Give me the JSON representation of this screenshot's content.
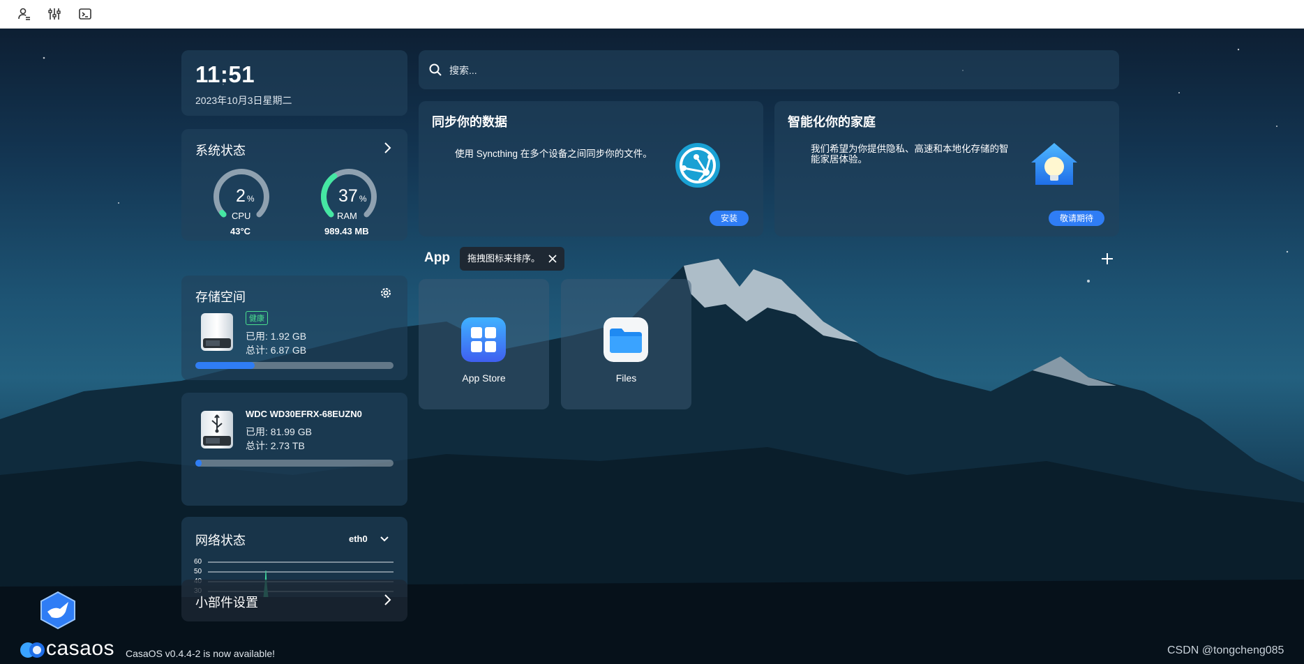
{
  "topbar": {
    "icons": [
      "user-settings-icon",
      "sliders-icon",
      "terminal-icon"
    ]
  },
  "clock": {
    "time": "11:51",
    "date": "2023年10月3日星期二"
  },
  "system_status": {
    "title": "系统状态",
    "cpu": {
      "value": "2",
      "unit": "%",
      "label": "CPU",
      "sub": "43°C",
      "percent": 2
    },
    "ram": {
      "value": "37",
      "unit": "%",
      "label": "RAM",
      "sub": "989.43 MB",
      "percent": 37
    }
  },
  "storage": {
    "title": "存储空间",
    "badge": "健康",
    "used": "已用: 1.92 GB",
    "total": "总计: 6.87 GB",
    "used_fraction": 0.3
  },
  "usb_disk": {
    "name": "WDC WD30EFRX-68EUZN0",
    "used": "已用: 81.99 GB",
    "total": "总计: 2.73 TB",
    "used_fraction": 0.03
  },
  "network": {
    "title": "网络状态",
    "interface": "eth0",
    "y_ticks": [
      "60",
      "50",
      "40",
      "30"
    ]
  },
  "widget_settings": {
    "label": "小部件设置"
  },
  "search": {
    "placeholder": "搜索..."
  },
  "cards": {
    "sync": {
      "title": "同步你的数据",
      "desc": "使用 Syncthing 在多个设备之间同步你的文件。",
      "button": "安装"
    },
    "home": {
      "title": "智能化你的家庭",
      "desc_line1": "我们希望为你提供隐私、高速和本地化存储的智",
      "desc_line2": "能家居体验。",
      "button": "敬请期待"
    }
  },
  "apps": {
    "title": "App",
    "tooltip": "拖拽图标来排序。",
    "items": [
      {
        "name": "App Store",
        "icon": "app-store-icon"
      },
      {
        "name": "Files",
        "icon": "folder-icon"
      }
    ]
  },
  "footer": {
    "logo_text": "casaos",
    "update_notice": "CasaOS v0.4.4-2 is now available!",
    "watermark": "CSDN @tongcheng085"
  },
  "colors": {
    "accent": "#2f7df5",
    "healthy": "#4be08e",
    "gauge_cpu": "#45e7a3",
    "gauge_track": "#8fa1b0"
  }
}
